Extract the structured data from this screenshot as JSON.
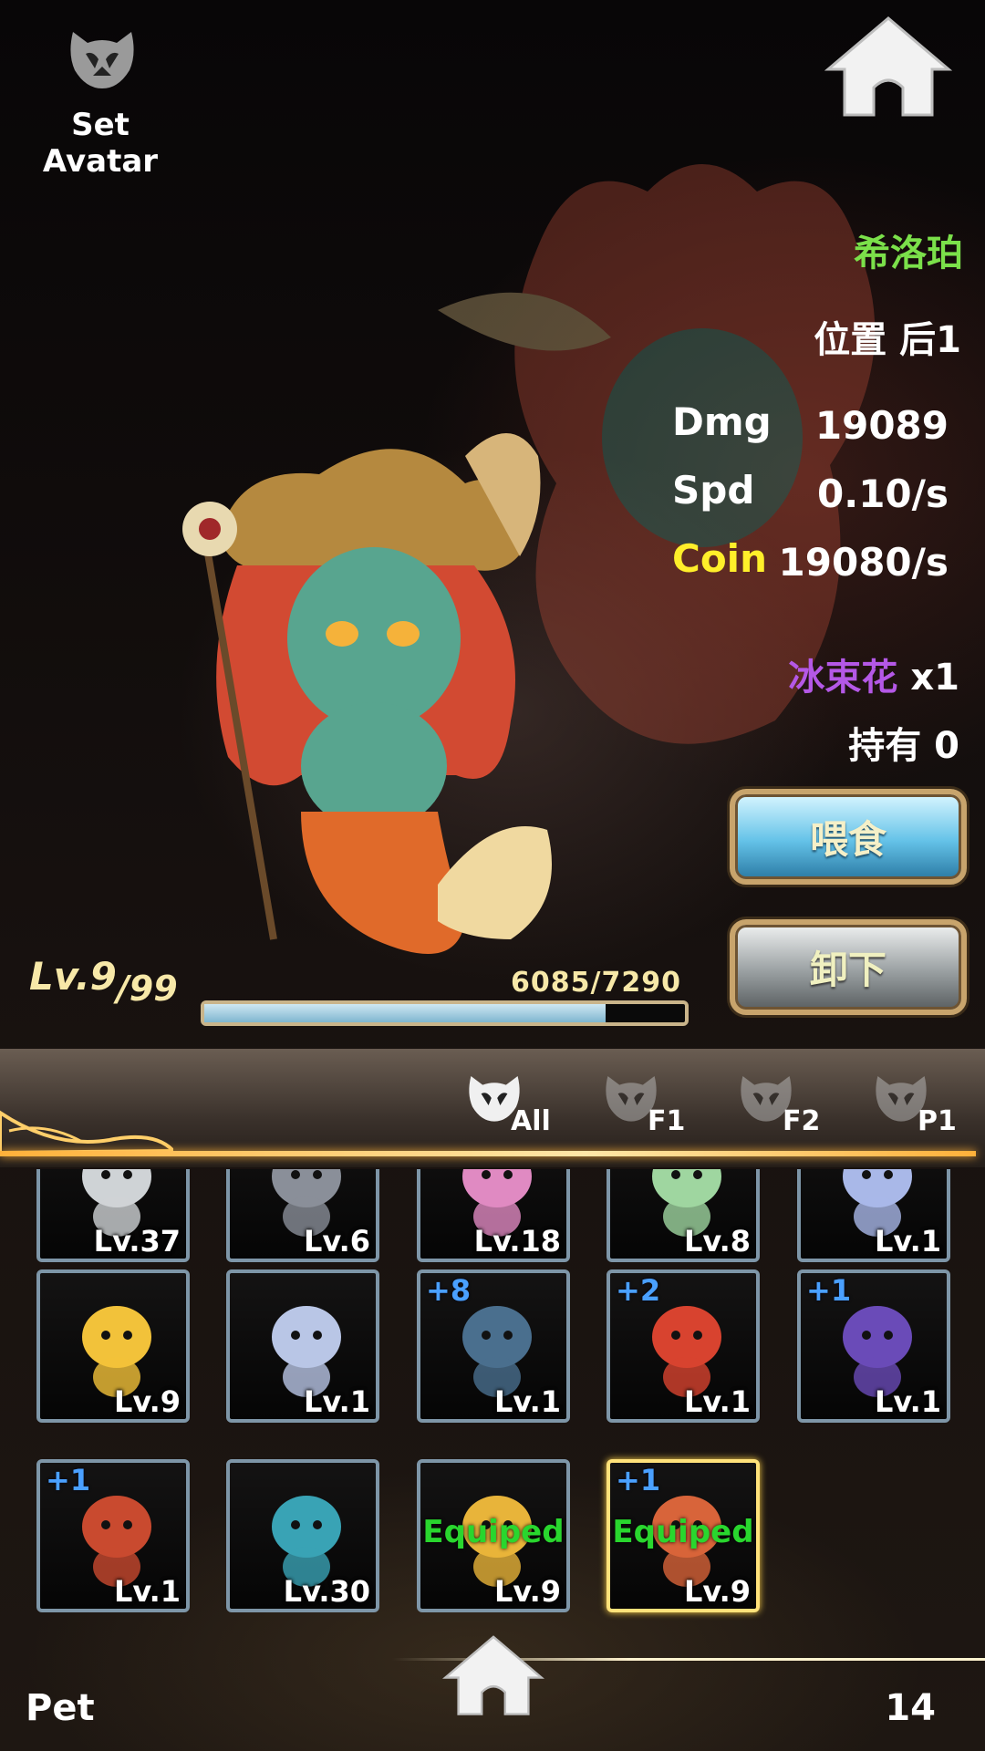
{
  "header": {
    "avatar_label": "Set Avatar",
    "avatar_icon": "mask-icon",
    "home_icon": "home-icon"
  },
  "pet": {
    "name": "希洛珀",
    "position_label": "位置 后1",
    "stats": [
      {
        "key": "Dmg",
        "value": "19089",
        "key_color": "#ffffff"
      },
      {
        "key": "Spd",
        "value": "0.10/s",
        "key_color": "#ffffff"
      },
      {
        "key": "Coin",
        "value": "19080/s",
        "key_color": "#ffef2a"
      }
    ],
    "item_name": "冰束花",
    "item_qty": "x1",
    "hold_label": "持有 0",
    "feed_label": "喂食",
    "unload_label": "卸下",
    "level": "Lv.9",
    "level_max": "/99",
    "exp_text": "6085/7290",
    "exp_fraction": 0.835
  },
  "tabs": [
    {
      "label": "All",
      "active": true
    },
    {
      "label": "F1",
      "active": false
    },
    {
      "label": "F2",
      "active": false
    },
    {
      "label": "P1",
      "active": false
    }
  ],
  "grid_rows": [
    [
      {
        "level": "Lv.37",
        "plus": "",
        "equipped": "",
        "color": "#cfd3d6"
      },
      {
        "level": "Lv.6",
        "plus": "",
        "equipped": "",
        "color": "#8a8f99"
      },
      {
        "level": "Lv.18",
        "plus": "",
        "equipped": "",
        "color": "#e08ac2"
      },
      {
        "level": "Lv.8",
        "plus": "",
        "equipped": "",
        "color": "#9fd6a0"
      },
      {
        "level": "Lv.1",
        "plus": "",
        "equipped": "",
        "color": "#a9b8e8"
      }
    ],
    [
      {
        "level": "Lv.9",
        "plus": "",
        "equipped": "",
        "color": "#f2c23a"
      },
      {
        "level": "Lv.1",
        "plus": "",
        "equipped": "",
        "color": "#b9c6e6"
      },
      {
        "level": "Lv.1",
        "plus": "+8",
        "equipped": "",
        "color": "#4a6f8e"
      },
      {
        "level": "Lv.1",
        "plus": "+2",
        "equipped": "",
        "color": "#d8432f"
      },
      {
        "level": "Lv.1",
        "plus": "+1",
        "equipped": "",
        "color": "#6a4bb8"
      }
    ],
    [
      {
        "level": "Lv.1",
        "plus": "+1",
        "equipped": "",
        "color": "#c94a2f"
      },
      {
        "level": "Lv.30",
        "plus": "",
        "equipped": "",
        "color": "#39a3b5"
      },
      {
        "level": "Lv.9",
        "plus": "",
        "equipped": "Equiped",
        "color": "#e8b43a"
      },
      {
        "level": "Lv.9",
        "plus": "+1",
        "equipped": "Equiped",
        "color": "#d8643a",
        "selected": true
      }
    ]
  ],
  "footer": {
    "title": "Pet",
    "count": "14"
  }
}
